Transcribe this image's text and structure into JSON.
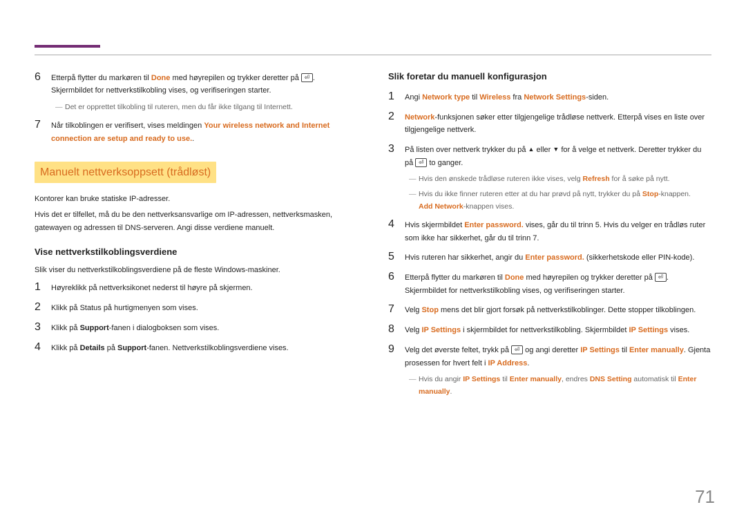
{
  "pageNumber": "71",
  "left": {
    "step6": {
      "pre": "Etterpå flytter du markøren til ",
      "done": "Done",
      "mid": " med høyrepilen og trykker deretter på ",
      "post": ". Skjermbildet for nettverkstilkobling vises, og verifiseringen starter."
    },
    "step6note": "Det er opprettet tilkobling til ruteren, men du får ikke tilgang til Internett.",
    "step7": {
      "pre": "Når tilkoblingen er verifisert, vises meldingen ",
      "msg": "Your wireless network and Internet connection are setup and ready to use."
    },
    "sectionTitle": "Manuelt nettverksoppsett (trådløst)",
    "intro1": "Kontorer kan bruke statiske IP-adresser.",
    "intro2": "Hvis det er tilfellet, må du be den nettverksansvarlige om IP-adressen, nettverksmasken, gatewayen og adressen til DNS-serveren. Angi disse verdiene manuelt.",
    "subTitle": "Vise nettverkstilkoblingsverdiene",
    "subIntro": "Slik viser du nettverkstilkoblingsverdiene på de fleste Windows-maskiner.",
    "l1": "Høyreklikk på nettverksikonet nederst til høyre på skjermen.",
    "l2": "Klikk på Status på hurtigmenyen som vises.",
    "l3_pre": "Klikk på ",
    "l3_bold": "Support",
    "l3_post": "-fanen i dialogboksen som vises.",
    "l4_pre": "Klikk på ",
    "l4_b1": "Details",
    "l4_mid": " på ",
    "l4_b2": "Support",
    "l4_post": "-fanen. Nettverkstilkoblingsverdiene vises."
  },
  "right": {
    "subTitle": "Slik foretar du manuell konfigurasjon",
    "r1": {
      "pre": "Angi ",
      "a1": "Network type",
      "mid": " til ",
      "a2": "Wireless",
      "mid2": " fra ",
      "a3": "Network Settings",
      "post": "-siden."
    },
    "r2": {
      "a": "Network",
      "post": "-funksjonen søker etter tilgjengelige trådløse nettverk. Etterpå vises en liste over tilgjengelige nettverk."
    },
    "r3": {
      "pre": "På listen over nettverk trykker du på ",
      "mid": " eller ",
      "mid2": " for å velge et nettverk. Deretter trykker du på ",
      "post": " to ganger."
    },
    "r3n1": {
      "pre": "Hvis den ønskede trådløse ruteren ikke vises, velg ",
      "a": "Refresh",
      "post": " for å søke på nytt."
    },
    "r3n2": {
      "pre": "Hvis du ikke finner ruteren etter at du har prøvd på nytt, trykker du på ",
      "a": "Stop",
      "post": "-knappen."
    },
    "r3n3": {
      "a": "Add Network",
      "post": "-knappen vises."
    },
    "r4": {
      "pre": "Hvis skjermbildet ",
      "a": "Enter password.",
      "post": " vises, går du til trinn 5. Hvis du velger en trådløs ruter som ikke har sikkerhet, går du til trinn 7."
    },
    "r5": {
      "pre": "Hvis ruteren har sikkerhet, angir du ",
      "a": "Enter password.",
      "post": " (sikkerhetskode eller PIN-kode)."
    },
    "r6": {
      "pre": "Etterpå flytter du markøren til ",
      "a": "Done",
      "mid": " med høyrepilen og trykker deretter på ",
      "post": ". Skjermbildet for nettverkstilkobling vises, og verifiseringen starter."
    },
    "r7": {
      "pre": "Velg ",
      "a": "Stop",
      "post": " mens det blir gjort forsøk på nettverkstilkoblinger. Dette stopper tilkoblingen."
    },
    "r8": {
      "pre": "Velg ",
      "a1": "IP Settings",
      "mid": " i skjermbildet for nettverkstilkobling. Skjermbildet ",
      "a2": "IP Settings",
      "post": " vises."
    },
    "r9": {
      "pre": "Velg det øverste feltet, trykk på ",
      "mid": " og angi deretter ",
      "a1": "IP Settings",
      "mid2": " til ",
      "a2": "Enter manually",
      "post": ". Gjenta prosessen for hvert felt i ",
      "a3": "IP Address",
      "dot": "."
    },
    "r9n": {
      "pre": "Hvis du angir ",
      "a1": "IP Settings",
      "mid": " til ",
      "a2": "Enter manually",
      "mid2": ", endres ",
      "a3": "DNS Setting",
      "mid3": " automatisk til ",
      "a4": "Enter manually",
      "dot": "."
    }
  }
}
